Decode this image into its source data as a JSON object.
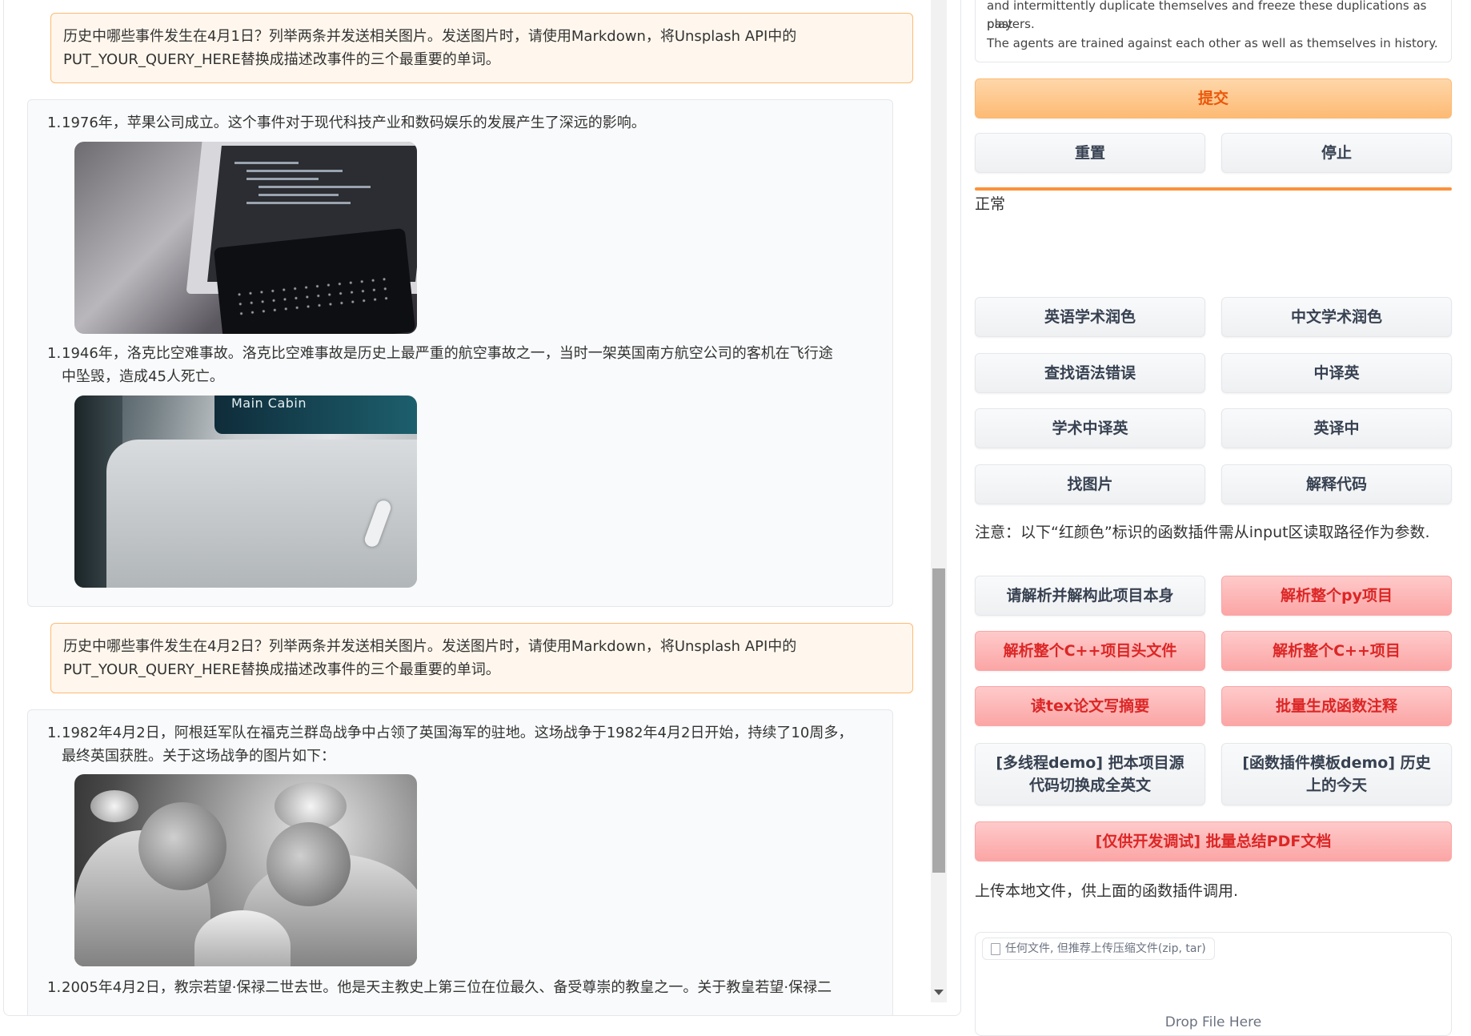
{
  "chat": {
    "messages": [
      {
        "role": "user",
        "lines": [
          "历史中哪些事件发生在4月1日？列举两条并发送相关图片。发送图片时，请使用Markdown，将Unsplash API中的",
          "PUT_YOUR_QUERY_HERE替换成描述改事件的三个最重要的单词。"
        ]
      },
      {
        "role": "bot",
        "items": [
          {
            "num": "1.",
            "lines": [
              "1976年，苹果公司成立。这个事件对于现代科技产业和数码娱乐的发展产生了深远的影响。"
            ],
            "image": "computer-photo"
          },
          {
            "num": "1.",
            "lines": [
              "1946年，洛克比空难事故。洛克比空难事故是历史上最严重的航空事故之一，当时一架英国南方航空公司的客机在飞行途",
              "中坠毁，造成45人死亡。"
            ],
            "image": "airplane-cabin-photo",
            "image_text": "Main Cabin"
          }
        ]
      },
      {
        "role": "user",
        "lines": [
          "历史中哪些事件发生在4月2日？列举两条并发送相关图片。发送图片时，请使用Markdown，将Unsplash API中的",
          "PUT_YOUR_QUERY_HERE替换成描述改事件的三个最重要的单词。"
        ]
      },
      {
        "role": "bot",
        "items": [
          {
            "num": "1.",
            "lines": [
              "1982年4月2日，阿根廷军队在福克兰群岛战争中占领了英国海军的驻地。这场战争于1982年4月2日开始，持续了10周多，",
              "最终英国获胜。关于这场战争的图片如下："
            ],
            "image": "surgery-photo"
          },
          {
            "num": "1.",
            "lines": [
              "2005年4月2日，教宗若望·保禄二世去世。他是天主教史上第三位在位最久、备受尊崇的教皇之一。关于教皇若望·保禄二"
            ]
          }
        ]
      }
    ]
  },
  "info_box": {
    "lines": [
      "and intermittently duplicate themselves and freeze these duplications as past",
      "players.",
      "The agents are trained against each other as well as themselves in history."
    ]
  },
  "controls": {
    "submit": "提交",
    "reset": "重置",
    "stop": "停止",
    "status": "正常"
  },
  "plugins": {
    "basic": [
      "英语学术润色",
      "中文学术润色",
      "查找语法错误",
      "中译英",
      "学术中译英",
      "英译中",
      "找图片",
      "解释代码"
    ],
    "note": "注意：以下“红颜色”标识的函数插件需从input区读取路径作为参数.",
    "advanced": [
      {
        "label": "请解析并解构此项目本身",
        "style": "gray"
      },
      {
        "label": "解析整个py项目",
        "style": "red"
      },
      {
        "label": "解析整个C++项目头文件",
        "style": "red"
      },
      {
        "label": "解析整个C++项目",
        "style": "red"
      },
      {
        "label": "读tex论文写摘要",
        "style": "red"
      },
      {
        "label": "批量生成函数注释",
        "style": "red"
      },
      {
        "label": "[多线程demo] 把本项目源代码切换成全英文",
        "style": "gray"
      },
      {
        "label": "[函数插件模板demo] 历史上的今天",
        "style": "gray"
      }
    ],
    "wide": "[仅供开发调试] 批量总结PDF文档"
  },
  "upload": {
    "note": "上传本地文件，供上面的函数插件调用.",
    "label": "任何文件, 但推荐上传压缩文件(zip, tar)",
    "drop_text": "Drop File Here"
  },
  "colors": {
    "accent_orange": "#fb923c",
    "plugin_red": "#dc2626",
    "user_bubble_bg": "#fff7ed"
  }
}
